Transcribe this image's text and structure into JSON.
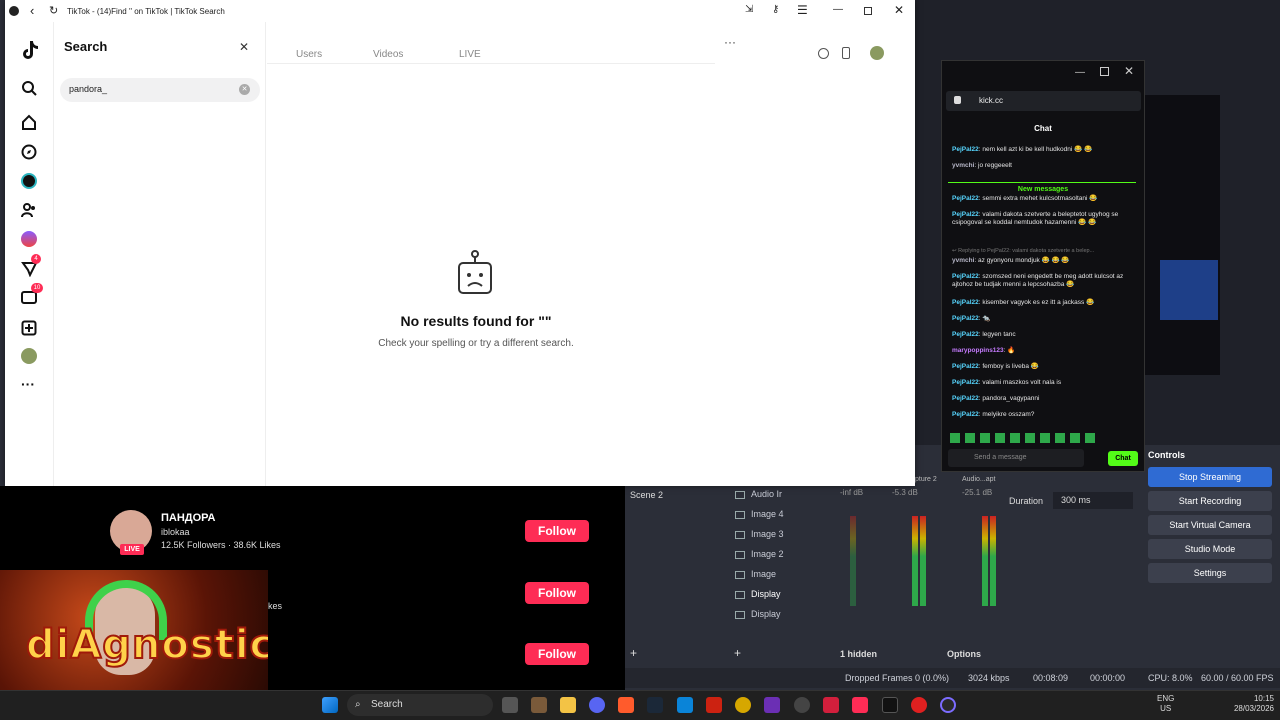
{
  "browser": {
    "tab_title": "TikTok - (14)Find '' on TikTok | TikTok Search"
  },
  "search": {
    "heading": "Search",
    "query": "pandora_"
  },
  "results": {
    "tabs": [
      "Users",
      "Videos",
      "LIVE"
    ],
    "empty_title": "No results found for \"\"",
    "empty_subtitle": "Check your spelling or try a different search."
  },
  "rail": {
    "badge_messages": "4",
    "badge_inbox": "10"
  },
  "tiktok_results": {
    "user_name": "ПАНДОРА",
    "user_handle": "iblokaa",
    "user_stats": "12.5K Followers · 38.6K Likes",
    "live_badge": "LIVE",
    "follow_label": "Follow",
    "partial_text": "kes"
  },
  "kick": {
    "url": "kick.cc",
    "header": "Chat",
    "new_messages": "New messages",
    "input_placeholder": "Send a message",
    "send_label": "Chat",
    "messages": [
      {
        "nick": "PejPal22",
        "text": ": nem kell azt ki be kell hudkodni 😂 😂"
      },
      {
        "nick": "yvmchi",
        "text": ": jo reggeeelt"
      },
      {
        "nick": "PejPal22",
        "text": ": semmi extra mehet kulcsotmasoltani 😂"
      },
      {
        "nick": "PejPal22",
        "text": ": valami dakota szetverte a beleptetot ugyhog se csipogoval se koddal nemtudok hazamenni 😂 😂"
      },
      {
        "nick": "",
        "text": "↩ Replying to PejPal22: valami dakota szetverte a belep..."
      },
      {
        "nick": "yvmchi",
        "text": ": az gyonyoru mondjuk 😂 😂 😂"
      },
      {
        "nick": "PejPal22",
        "text": ": szomszed neni engedett be meg adott kulcsot az ajtohoz be tudjak menni a lepcsohazba 😂"
      },
      {
        "nick": "PejPal22",
        "text": ": kisember vagyok es ez itt a jackass 😂"
      },
      {
        "nick": "PejPal22",
        "text": ": 🐀"
      },
      {
        "nick": "PejPal22",
        "text": ": legyen tanc"
      },
      {
        "nick": "marypoppins123",
        "text": ": 🔥"
      },
      {
        "nick": "PejPal22",
        "text": ": femboy is liveba 😂"
      },
      {
        "nick": "PejPal22",
        "text": ": valami maszkos volt nala is"
      },
      {
        "nick": "PejPal22",
        "text": ": pandora_vagypanni"
      },
      {
        "nick": "PejPal22",
        "text": ": melyikre osszam?"
      }
    ]
  },
  "obs": {
    "scene": "Scene 2",
    "sources": [
      "Audio Ir",
      "Image 4",
      "Image 3",
      "Image 2",
      "Image",
      "Display",
      "Display"
    ],
    "controls_title": "Controls",
    "controls": [
      "Stop Streaming",
      "Start Recording",
      "Start Virtual Camera",
      "Studio Mode",
      "Settings"
    ],
    "transition_label": "Duration",
    "transition_value": "300 ms",
    "mixer_db1": "-inf dB",
    "mixer_db2": "-5.3 dB",
    "mixer_db3": "-25.1 dB",
    "mixer_label": "pture 2",
    "mixer_label2": "Audio...apt",
    "hidden": "1 hidden",
    "options": "Options",
    "status": {
      "dropped": "Dropped Frames 0 (0.0%)",
      "kbps": "3024 kbps",
      "time1": "00:08:09",
      "time2": "00:00:00",
      "cpu": "CPU: 8.0%",
      "fps": "60.00 / 60.00 FPS"
    }
  },
  "taskbar": {
    "search": "Search",
    "lang1": "ENG",
    "lang2": "US",
    "time": "10:15",
    "date": "28/03/2026"
  },
  "colors": {
    "tiktok_red": "#fe2c55",
    "kick_green": "#53fc18",
    "obs_blue": "#2f6bd3"
  }
}
